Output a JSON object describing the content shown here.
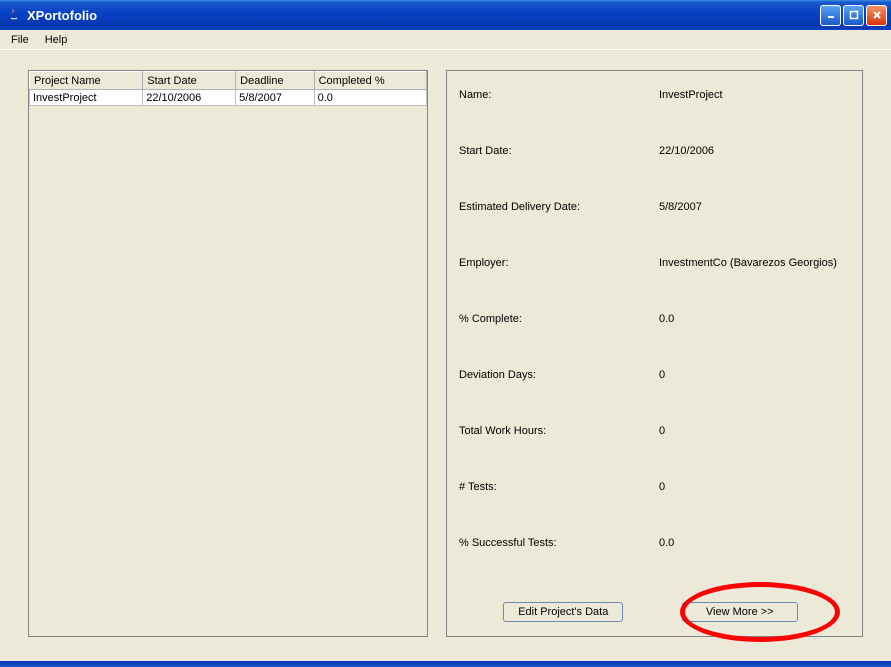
{
  "window": {
    "title": "XPortofolio"
  },
  "menubar": {
    "file": "File",
    "help": "Help"
  },
  "table": {
    "headers": {
      "project_name": "Project Name",
      "start_date": "Start Date",
      "deadline": "Deadline",
      "completed_pct": "Completed %"
    },
    "rows": [
      {
        "project_name": "InvestProject",
        "start_date": "22/10/2006",
        "deadline": "5/8/2007",
        "completed_pct": "0.0"
      }
    ]
  },
  "details": {
    "labels": {
      "name": "Name:",
      "start_date": "Start Date:",
      "est_delivery": "Estimated Delivery Date:",
      "employer": "Employer:",
      "pct_complete": "% Complete:",
      "deviation_days": "Deviation Days:",
      "total_work_hours": "Total Work Hours:",
      "num_tests": "# Tests:",
      "pct_successful_tests": "% Successful Tests:"
    },
    "values": {
      "name": "InvestProject",
      "start_date": "22/10/2006",
      "est_delivery": "5/8/2007",
      "employer": "InvestmentCo (Bavarezos Georgios)",
      "pct_complete": "0.0",
      "deviation_days": "0",
      "total_work_hours": "0",
      "num_tests": "0",
      "pct_successful_tests": "0.0"
    }
  },
  "buttons": {
    "edit": "Edit Project's Data",
    "view_more": "View More >>"
  }
}
